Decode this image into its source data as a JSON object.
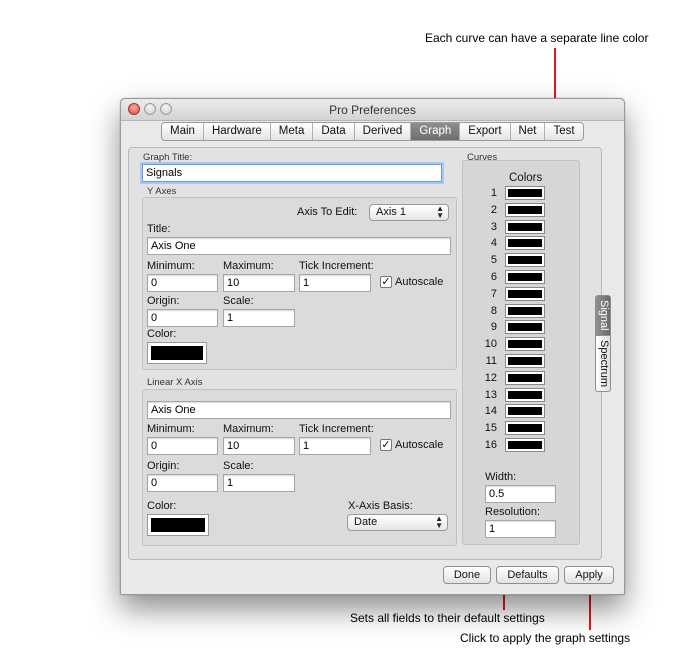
{
  "annotations": {
    "top": "Each curve can have a separate line color",
    "defaults": "Sets all fields to their default settings",
    "apply": "Click to apply the graph settings"
  },
  "window": {
    "title": "Pro Preferences"
  },
  "tabs": [
    {
      "label": "Main"
    },
    {
      "label": "Hardware"
    },
    {
      "label": "Meta"
    },
    {
      "label": "Data"
    },
    {
      "label": "Derived"
    },
    {
      "label": "Graph",
      "selected": true
    },
    {
      "label": "Export"
    },
    {
      "label": "Net"
    },
    {
      "label": "Test"
    }
  ],
  "graph": {
    "title_label": "Graph Title:",
    "title_value": "Signals"
  },
  "y_axes": {
    "section": "Y Axes",
    "axis_to_edit_label": "Axis To Edit:",
    "axis_to_edit_value": "Axis 1",
    "title_label": "Title:",
    "title_value": "Axis One",
    "min_label": "Minimum:",
    "min_value": "0",
    "max_label": "Maximum:",
    "max_value": "10",
    "tick_label": "Tick Increment:",
    "tick_value": "1",
    "autoscale_label": "Autoscale",
    "autoscale_checked": true,
    "origin_label": "Origin:",
    "origin_value": "0",
    "scale_label": "Scale:",
    "scale_value": "1",
    "color_label": "Color:",
    "color": "#000000"
  },
  "x_axis": {
    "section": "Linear X Axis",
    "title_value": "Axis One",
    "min_label": "Minimum:",
    "min_value": "0",
    "max_label": "Maximum:",
    "max_value": "10",
    "tick_label": "Tick Increment:",
    "tick_value": "1",
    "autoscale_label": "Autoscale",
    "autoscale_checked": true,
    "origin_label": "Origin:",
    "origin_value": "0",
    "scale_label": "Scale:",
    "scale_value": "1",
    "color_label": "Color:",
    "color": "#000000",
    "basis_label": "X-Axis Basis:",
    "basis_value": "Date"
  },
  "curves": {
    "section": "Curves",
    "colors_label": "Colors",
    "items": [
      {
        "num": "1",
        "color": "#000000"
      },
      {
        "num": "2",
        "color": "#000000"
      },
      {
        "num": "3",
        "color": "#000000"
      },
      {
        "num": "4",
        "color": "#000000"
      },
      {
        "num": "5",
        "color": "#000000"
      },
      {
        "num": "6",
        "color": "#000000"
      },
      {
        "num": "7",
        "color": "#000000"
      },
      {
        "num": "8",
        "color": "#000000"
      },
      {
        "num": "9",
        "color": "#000000"
      },
      {
        "num": "10",
        "color": "#000000"
      },
      {
        "num": "11",
        "color": "#000000"
      },
      {
        "num": "12",
        "color": "#000000"
      },
      {
        "num": "13",
        "color": "#000000"
      },
      {
        "num": "14",
        "color": "#000000"
      },
      {
        "num": "15",
        "color": "#000000"
      },
      {
        "num": "16",
        "color": "#000000"
      }
    ],
    "width_label": "Width:",
    "width_value": "0.5",
    "resolution_label": "Resolution:",
    "resolution_value": "1"
  },
  "side_tabs": [
    {
      "label": "Signal",
      "selected": true
    },
    {
      "label": "Spectrum"
    }
  ],
  "buttons": {
    "done": "Done",
    "defaults": "Defaults",
    "apply": "Apply"
  }
}
